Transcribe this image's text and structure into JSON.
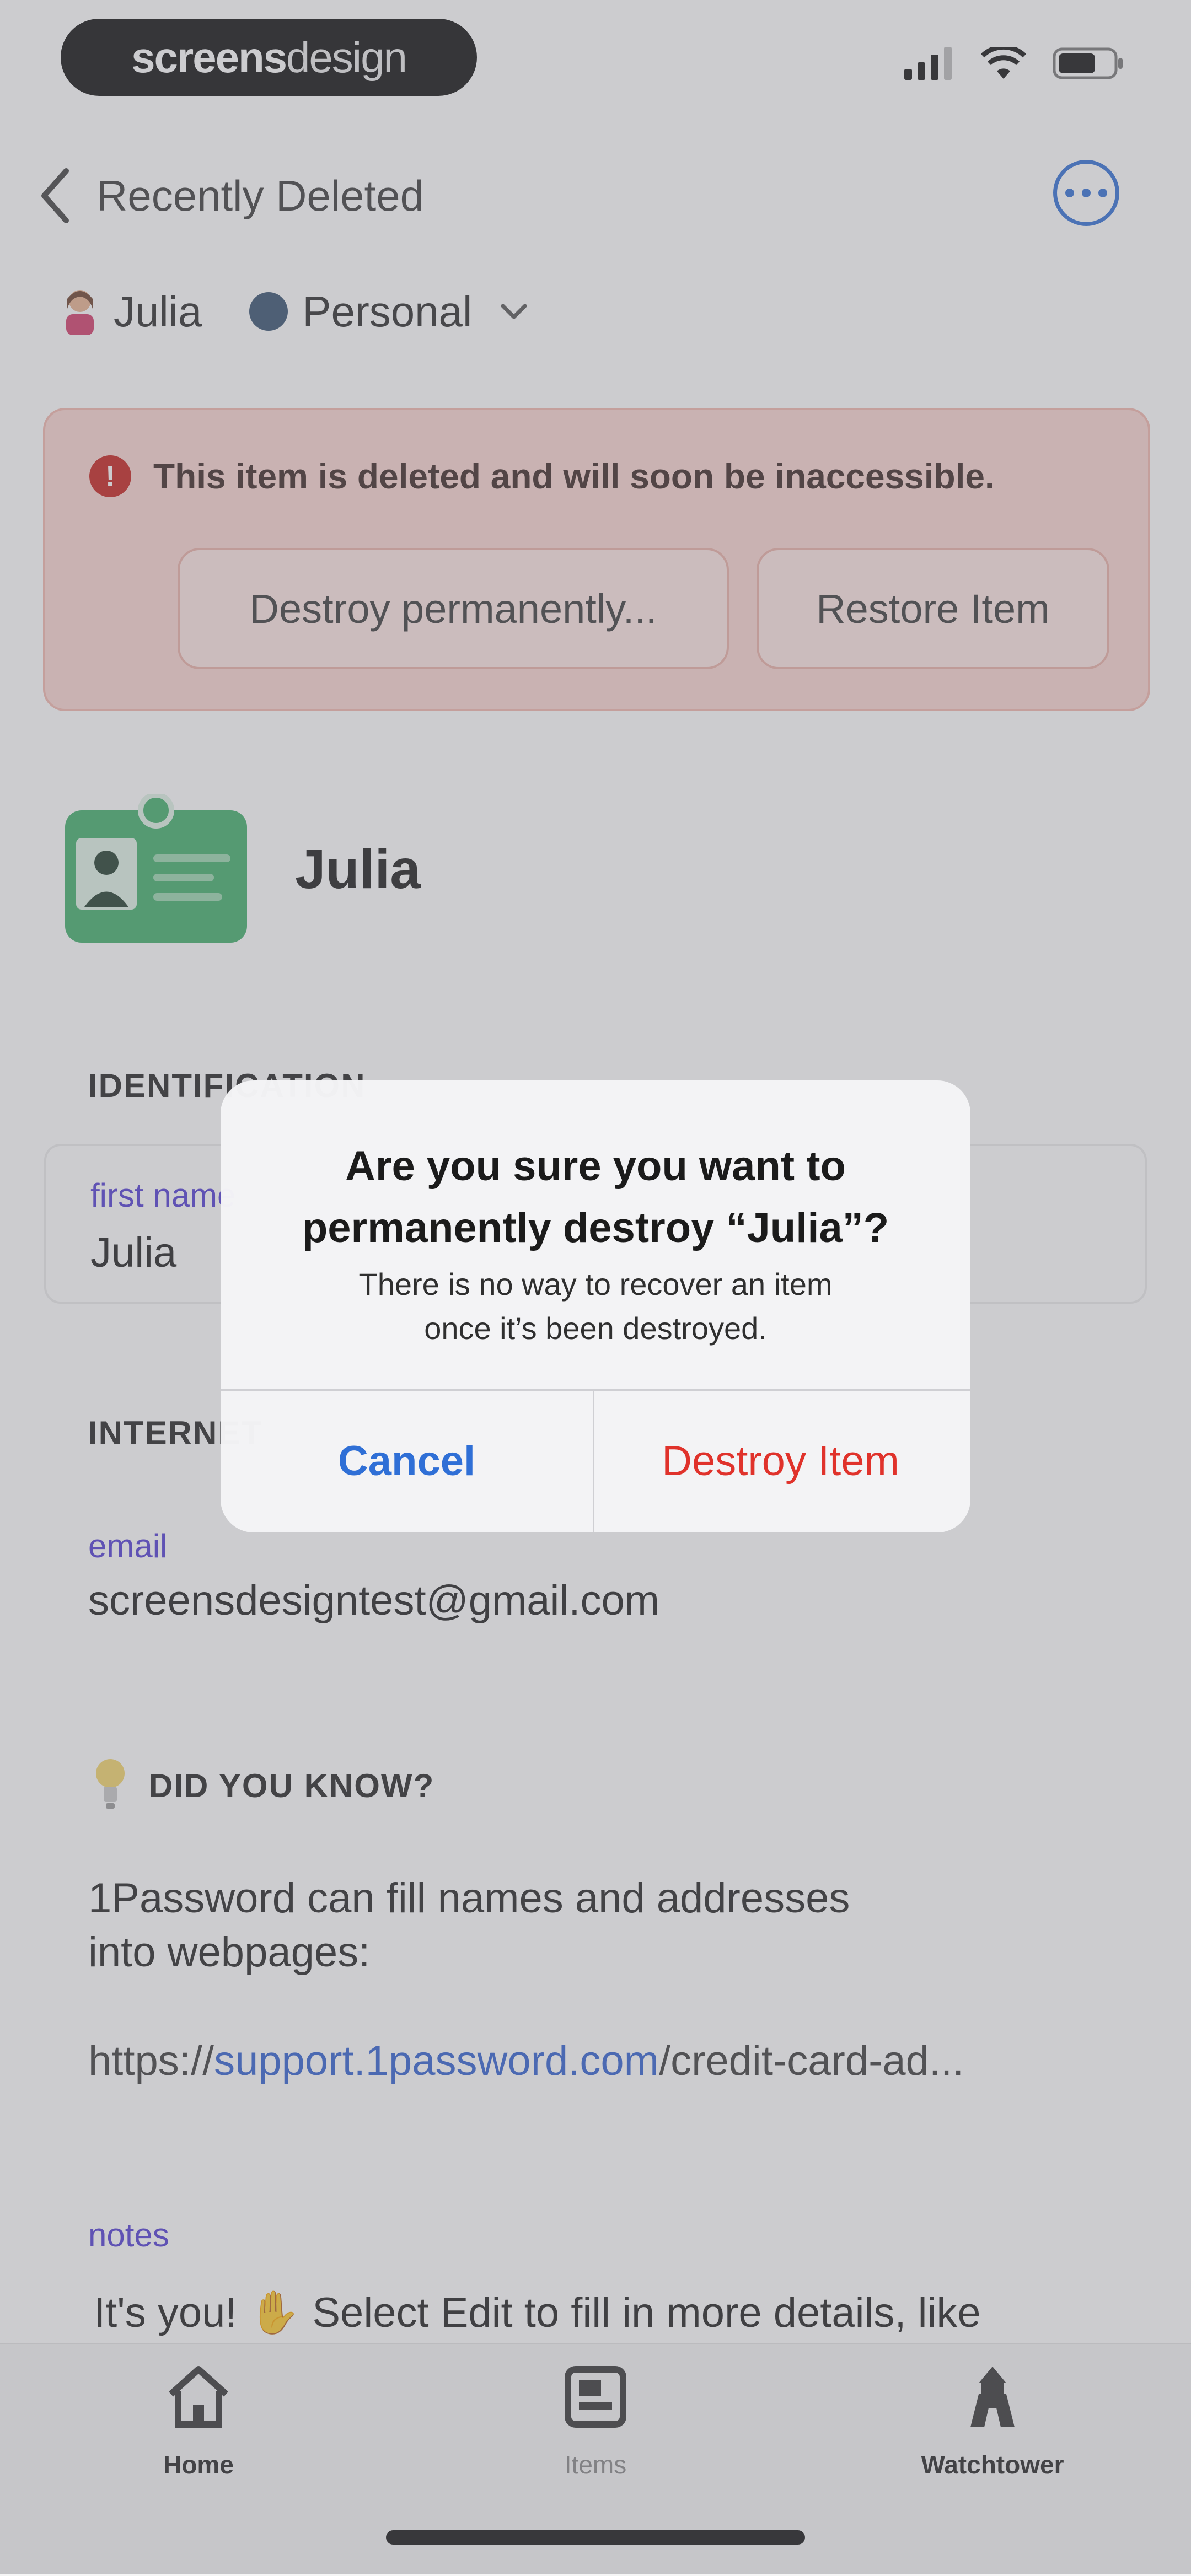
{
  "status": {
    "brand_bold": "screens",
    "brand_light": "design"
  },
  "nav": {
    "back_title": "Recently Deleted"
  },
  "account": {
    "user": "Julia",
    "vault": "Personal"
  },
  "banner": {
    "message": "This item is deleted and will soon be inaccessible.",
    "destroy_label": "Destroy permanently...",
    "restore_label": "Restore Item",
    "icon_glyph": "!"
  },
  "item": {
    "title": "Julia"
  },
  "sections": {
    "identification": "IDENTIFICATION",
    "internet": "INTERNET",
    "tip": "DID YOU KNOW?"
  },
  "fields": {
    "first_name_label": "first name",
    "first_name_value": "Julia",
    "email_label": "email",
    "email_value": "screensdesigntest@gmail.com",
    "notes_label": "notes",
    "notes_value": "It's you! ✋ Select Edit to fill in more details, like"
  },
  "tip": {
    "text_line1": "1Password can fill names and addresses",
    "text_line2": "into webpages:",
    "link_prefix": "https://",
    "link_domain": "support.1password.com",
    "link_suffix": "/credit-card-ad..."
  },
  "tabs": [
    {
      "label": "Home"
    },
    {
      "label": "Items"
    },
    {
      "label": "Watchtower"
    }
  ],
  "alert": {
    "title_line1": "Are you sure you want to",
    "title_line2": "permanently destroy “Julia”?",
    "message_line1": "There is no way to recover an item",
    "message_line2": "once it’s been destroyed.",
    "cancel_label": "Cancel",
    "destroy_label": "Destroy Item"
  },
  "colors": {
    "accent_blue": "#2f6fd6",
    "destructive_red": "#e0322b",
    "banner_bg": "#fbd6d1",
    "field_label_purple": "#4f3bd3",
    "identity_green": "#3fae6a"
  }
}
